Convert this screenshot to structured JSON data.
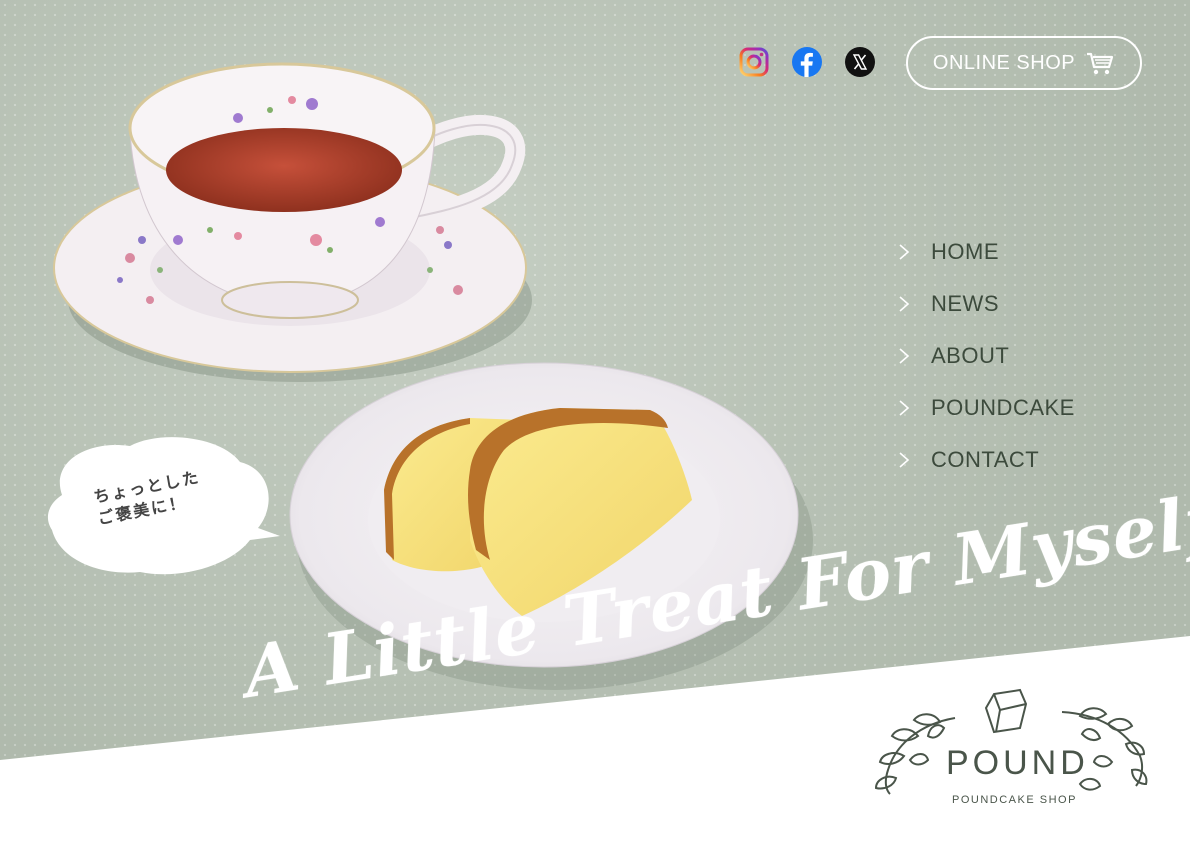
{
  "social": {
    "instagram": {
      "icon": "instagram-icon"
    },
    "facebook": {
      "icon": "facebook-icon"
    },
    "x": {
      "icon": "x-icon"
    }
  },
  "header": {
    "online_shop_label": "ONLINE SHOP",
    "online_shop_icon": "cart-icon"
  },
  "nav": {
    "items": [
      {
        "label": "HOME"
      },
      {
        "label": "NEWS"
      },
      {
        "label": "ABOUT"
      },
      {
        "label": "POUNDCAKE"
      },
      {
        "label": "CONTACT"
      }
    ]
  },
  "bubble": {
    "line1": "ちょっとした",
    "line2": "ご褒美に！"
  },
  "hero": {
    "tagline": "A Little Treat For Myself"
  },
  "logo": {
    "name": "POUND",
    "subtitle": "POUNDCAKE SHOP"
  },
  "colors": {
    "background": "#b9c4b6",
    "text_dark": "#3c4a3c",
    "white": "#ffffff",
    "instagram": "#d6249f",
    "facebook": "#1877f2",
    "x": "#111111"
  }
}
